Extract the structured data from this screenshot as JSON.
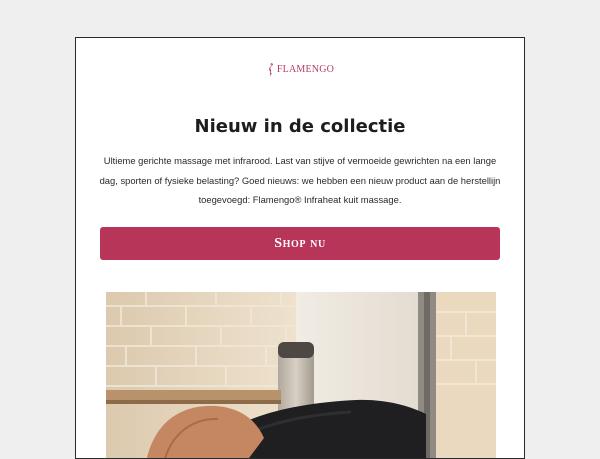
{
  "email": {
    "brand": {
      "logo_text": "FLAMENGO",
      "logo_icon": "flamingo-icon",
      "color": "#b83c5f"
    },
    "headline": "Nieuw in de collectie",
    "body_text": "Ultieme gerichte massage met infrarood. Last van stijve of vermoeide gewrichten na een lange dag, sporten of fysieke belasting? Goed nieuws: we hebben een nieuw product aan de herstellijn toegevoegd: Flamengo® Infraheat kuit massage.",
    "cta": {
      "label": "Shop nu",
      "color": "#b8355a"
    },
    "hero_image": {
      "subject": "product-photo"
    }
  }
}
